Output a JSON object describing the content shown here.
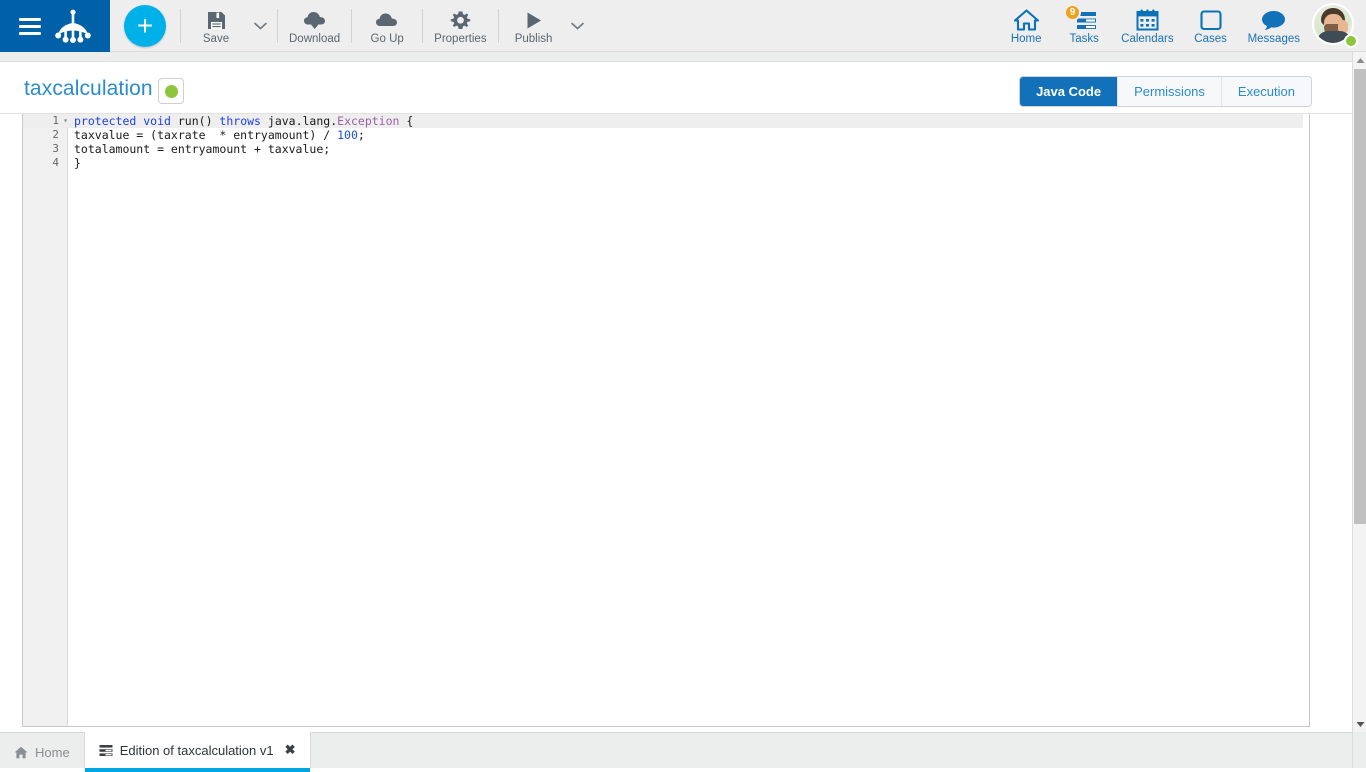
{
  "topbar": {
    "menu_icon": "hamburger-icon",
    "logo_icon": "bonita-frog-logo",
    "add_label": "+",
    "tools": [
      {
        "label": "Save",
        "icon": "floppy-disk-icon",
        "has_dropdown": true
      },
      {
        "label": "Download",
        "icon": "download-cloud-icon",
        "has_dropdown": false
      },
      {
        "label": "Go Up",
        "icon": "upload-cloud-icon",
        "has_dropdown": false
      },
      {
        "label": "Properties",
        "icon": "gear-icon",
        "has_dropdown": false
      },
      {
        "label": "Publish",
        "icon": "play-icon",
        "has_dropdown": true
      }
    ],
    "nav": [
      {
        "label": "Home",
        "icon": "home-icon",
        "badge": ""
      },
      {
        "label": "Tasks",
        "icon": "tasks-list-icon",
        "badge": "9"
      },
      {
        "label": "Calendars",
        "icon": "calendar-icon",
        "badge": ""
      },
      {
        "label": "Cases",
        "icon": "square-outline-icon",
        "badge": ""
      },
      {
        "label": "Messages",
        "icon": "speech-bubble-icon",
        "badge": ""
      }
    ],
    "avatar": {
      "name": "avatar",
      "status": "online"
    }
  },
  "title_band": {
    "title": "taxcalculation",
    "status_indicator": "green-dot",
    "tabs": [
      {
        "label": "Java Code",
        "active": true
      },
      {
        "label": "Permissions",
        "active": false
      },
      {
        "label": "Execution",
        "active": false
      }
    ]
  },
  "editor": {
    "lines": [
      {
        "num": "1",
        "fold": true,
        "active": true
      },
      {
        "num": "2",
        "fold": false,
        "active": false
      },
      {
        "num": "3",
        "fold": false,
        "active": false
      },
      {
        "num": "4",
        "fold": false,
        "active": false
      }
    ],
    "code": {
      "line1": "protected void run() throws java.lang.Exception {",
      "line2": "taxvalue = (taxrate  * entryamount) / 100;",
      "line3": "totalamount = entryamount + taxvalue;",
      "line4": "}"
    },
    "tokens": {
      "l1_protected": "protected ",
      "l1_void": "void ",
      "l1_run": "run() ",
      "l1_throws": "throws ",
      "l1_pkg": "java.lang.",
      "l1_exception": "Exception",
      "l1_brace": " {",
      "l2_a": "taxvalue = (taxrate  * entryamount) / ",
      "l2_num": "100",
      "l2_b": ";",
      "l3": "totalamount = entryamount + taxvalue;",
      "l4": "}"
    }
  },
  "taskbar": {
    "tabs": [
      {
        "label": "Home",
        "icon": "home-icon",
        "active": false,
        "closable": false
      },
      {
        "label": "Edition of taxcalculation v1",
        "icon": "document-lines-icon",
        "active": true,
        "closable": true,
        "close_glyph": "✖"
      }
    ]
  },
  "scrollbar": {
    "up_glyph": "▲",
    "down_glyph": "▼"
  },
  "colors": {
    "brand_blue": "#0060a8",
    "accent_cyan": "#00b0e8",
    "tab_active": "#1271b8",
    "link_blue": "#2b8ccc",
    "badge_orange": "#f0a11b",
    "status_green": "#8cc63e"
  }
}
